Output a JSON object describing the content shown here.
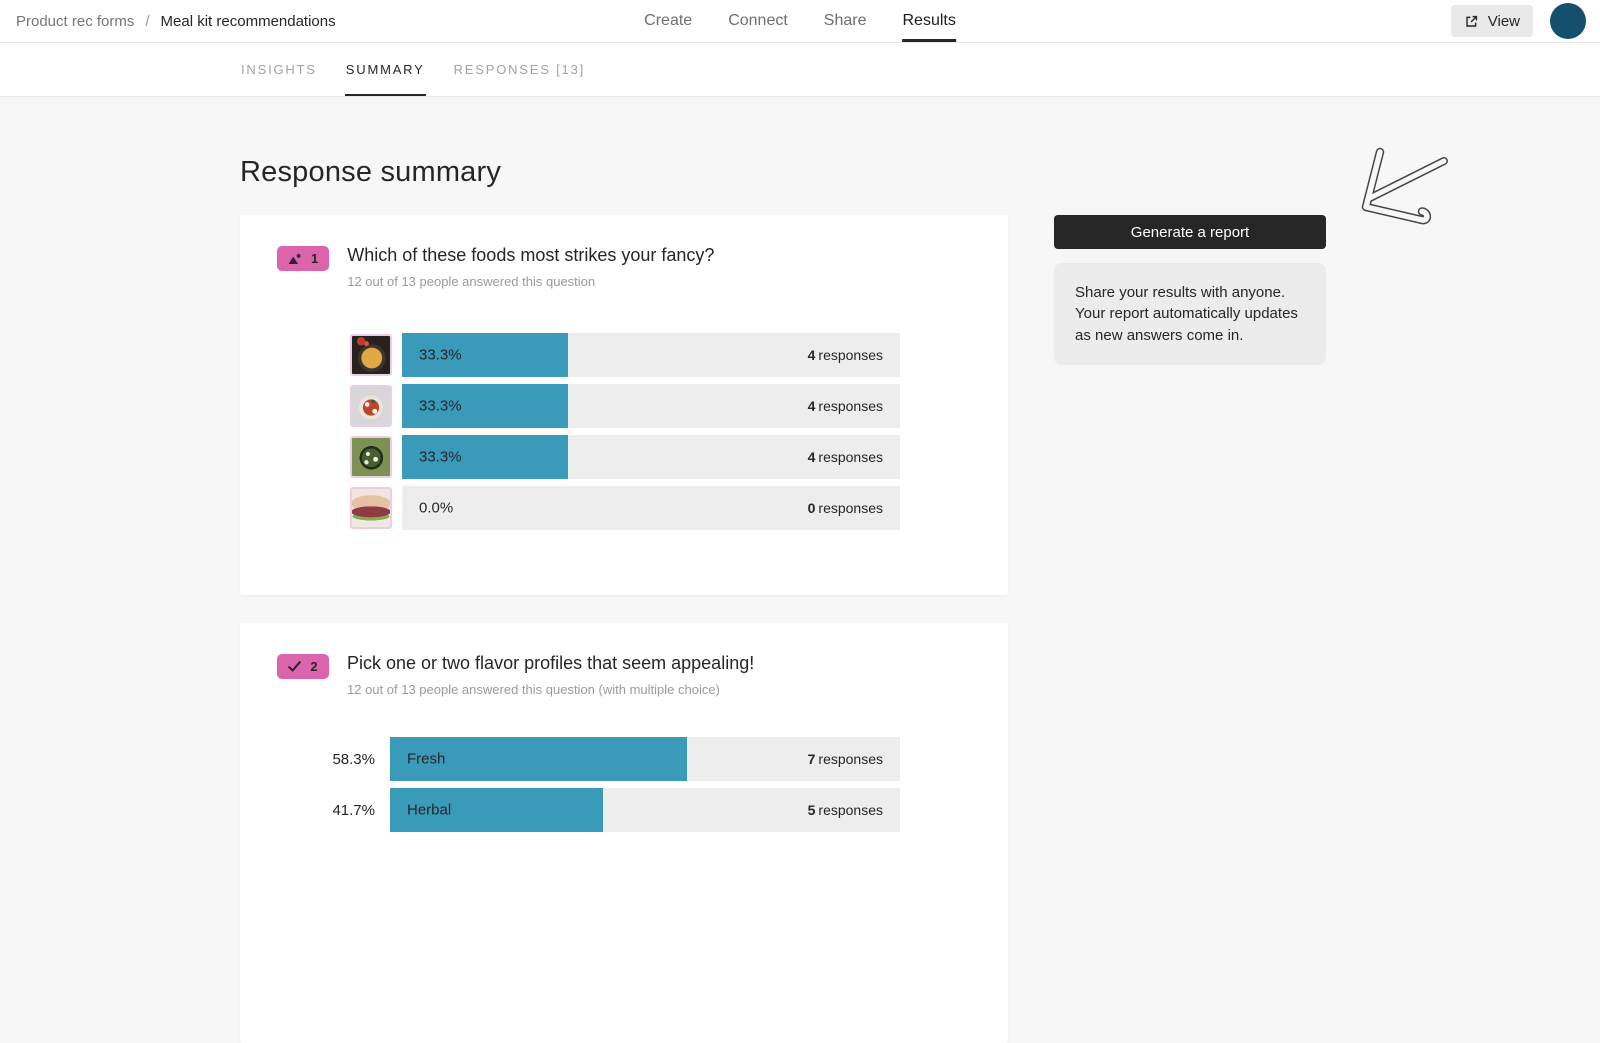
{
  "colors": {
    "accent": "#3a9aba",
    "badge": "#dc64ad",
    "avatar": "#14506e",
    "button_dark": "#262627",
    "track": "#ededed",
    "page_bg": "#f7f7f7"
  },
  "header": {
    "breadcrumb": {
      "parent": "Product rec forms",
      "separator": "/",
      "current": "Meal kit recommendations"
    },
    "nav": [
      {
        "label": "Create",
        "active": false
      },
      {
        "label": "Connect",
        "active": false
      },
      {
        "label": "Share",
        "active": false
      },
      {
        "label": "Results",
        "active": true
      }
    ],
    "view_button": {
      "label": "View",
      "icon": "external-link-icon"
    },
    "avatar": {
      "icon": "avatar-circle"
    }
  },
  "tabs": [
    {
      "label": "INSIGHTS",
      "active": false
    },
    {
      "label": "SUMMARY",
      "active": true
    },
    {
      "label": "RESPONSES [13]",
      "active": false
    }
  ],
  "page_title": "Response summary",
  "questions": [
    {
      "number": "1",
      "type": "picture_choice",
      "type_icon": "picture-choice-icon",
      "title": "Which of these foods most strikes your fancy?",
      "subtitle": "12 out of 13 people answered this question",
      "chart": {
        "type": "bar",
        "rows": [
          {
            "image": "fried-rice",
            "percent_label": "33.3%",
            "percent": 33.3,
            "count": "4",
            "count_unit": "responses"
          },
          {
            "image": "pizza",
            "percent_label": "33.3%",
            "percent": 33.3,
            "count": "4",
            "count_unit": "responses"
          },
          {
            "image": "salad-bowl",
            "percent_label": "33.3%",
            "percent": 33.3,
            "count": "4",
            "count_unit": "responses"
          },
          {
            "image": "veggie-burger",
            "percent_label": "0.0%",
            "percent": 0,
            "count": "0",
            "count_unit": "responses"
          }
        ]
      }
    },
    {
      "number": "2",
      "type": "multiple_choice",
      "type_icon": "checkmark-icon",
      "title": "Pick one or two flavor profiles that seem appealing!",
      "subtitle": "12 out of 13 people answered this question (with multiple choice)",
      "chart": {
        "type": "bar",
        "rows": [
          {
            "label": "Fresh",
            "percent_label": "58.3%",
            "percent": 58.3,
            "count": "7",
            "count_unit": "responses"
          },
          {
            "label": "Herbal",
            "percent_label": "41.7%",
            "percent": 41.7,
            "count": "5",
            "count_unit": "responses"
          }
        ]
      }
    }
  ],
  "sidebar": {
    "generate_button_label": "Generate a report",
    "info_text": "Share your results with anyone. Your report automatically updates as new answers come in.",
    "arrow_icon": "hand-drawn-arrow-icon"
  }
}
